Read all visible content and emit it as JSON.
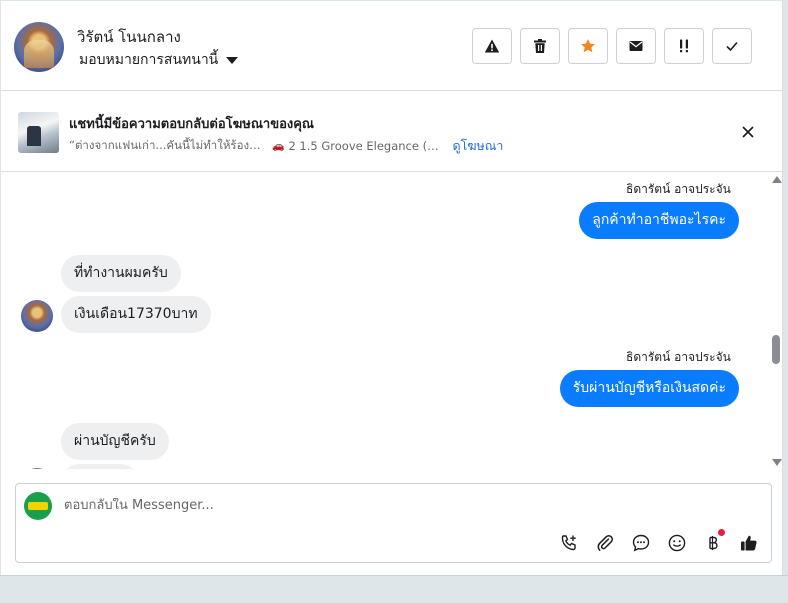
{
  "header": {
    "contact_name": "วิรัตน์ โนนกลาง",
    "assign_label": "มอบหมายการสนทนานี้",
    "actions": [
      {
        "name": "report-spam-button",
        "icon": "warning-icon"
      },
      {
        "name": "delete-button",
        "icon": "trash-icon"
      },
      {
        "name": "star-button",
        "icon": "star-icon"
      },
      {
        "name": "mark-unread-button",
        "icon": "envelope-icon"
      },
      {
        "name": "follow-up-button",
        "icon": "exclamation-icon"
      },
      {
        "name": "mark-done-button",
        "icon": "check-icon"
      }
    ]
  },
  "ad_banner": {
    "title": "แชทนี้มีข้อความตอบกลับต่อโฆษณาของคุณ",
    "quote": "“ต่างจากแฟนเก่า...คันนี้ไม่ทำให้ร้องไห้”",
    "car_icon": "car-icon",
    "model": "2 1.5 Groove Elegance (Se...",
    "link": "ดูโฆษณา"
  },
  "messages": [
    {
      "direction": "out",
      "sender": "ธิดารัตน์ อาจประจัน",
      "text": "ลูกค้าทำอาชีพอะไรคะ"
    },
    {
      "direction": "in",
      "text": "ที่ทำงานผมครับ"
    },
    {
      "direction": "in",
      "text": "เงินเดือน17370บาท"
    },
    {
      "direction": "out",
      "sender": "ธิดารัตน์ อาจประจัน",
      "text": "รับผ่านบัญชีหรือเงินสดค่ะ"
    },
    {
      "direction": "in",
      "text": "ผ่านบัญชีครับ"
    }
  ],
  "composer": {
    "placeholder": "ตอบกลับใน Messenger...",
    "value": "",
    "tools": [
      "call-plus-icon",
      "paperclip-icon",
      "speech-bubble-icon",
      "smiley-icon",
      "baht-icon",
      "thumbs-up-icon"
    ]
  },
  "colors": {
    "outgoing_bubble": "#0a7cff",
    "incoming_bubble": "#eeeff1",
    "star": "#f0861c",
    "link": "#216fdb",
    "notification_dot": "#e41e3f"
  }
}
